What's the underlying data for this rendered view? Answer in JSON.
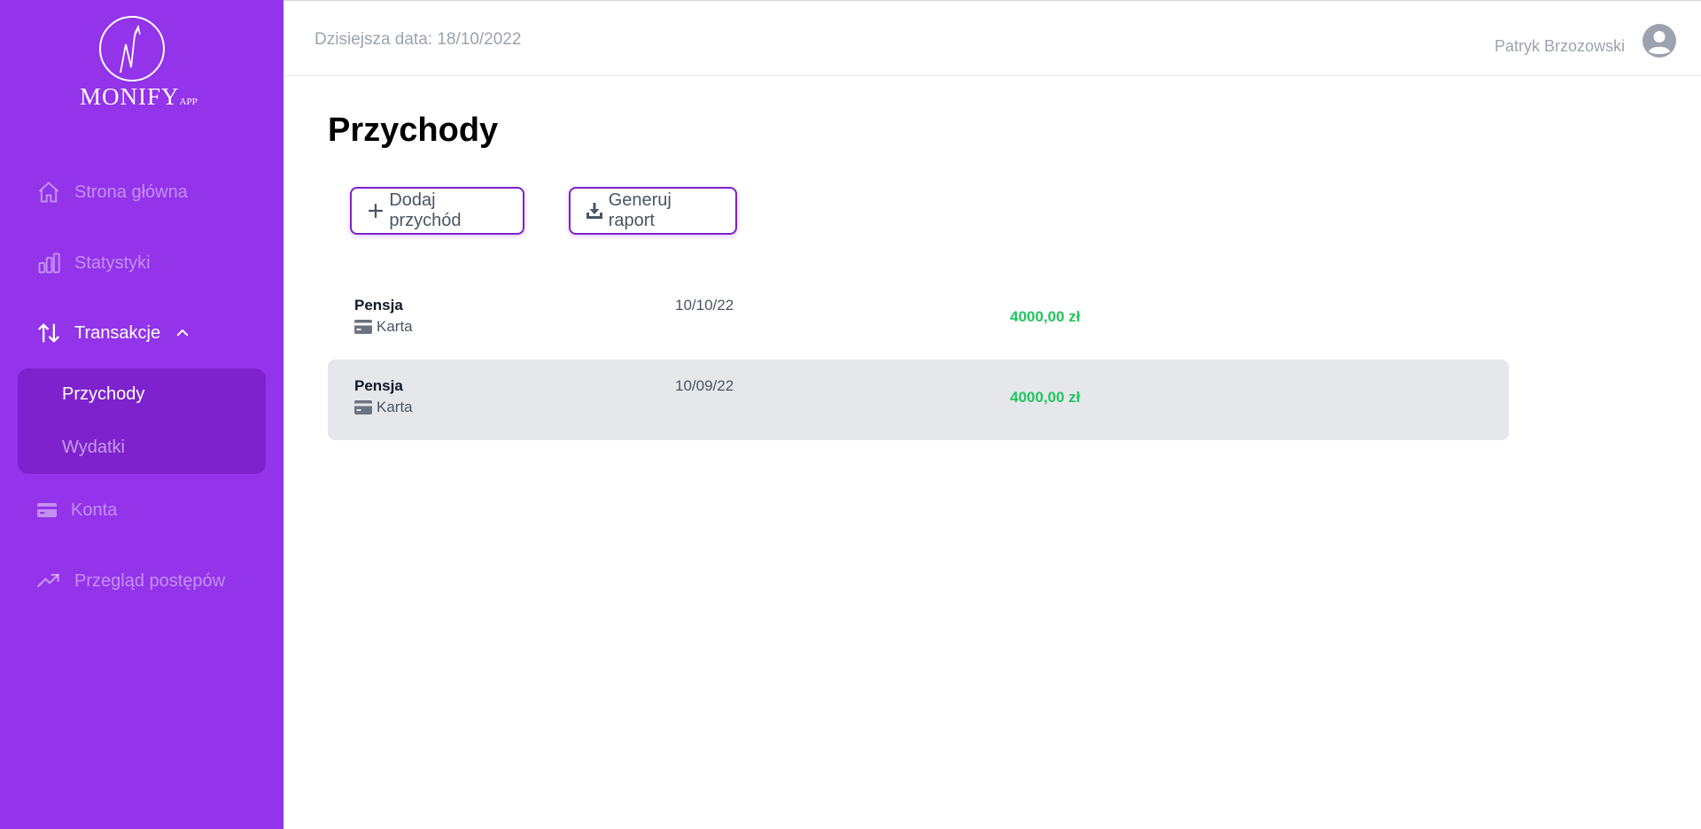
{
  "app": {
    "logo_text": "MONIFY",
    "logo_suffix": "APP"
  },
  "sidebar": {
    "items": [
      {
        "label": "Strona główna",
        "icon": "home-icon"
      },
      {
        "label": "Statystyki",
        "icon": "bar-chart-icon"
      },
      {
        "label": "Transakcje",
        "icon": "arrows-up-down-icon",
        "expanded": true
      },
      {
        "label": "Konta",
        "icon": "credit-card-icon"
      },
      {
        "label": "Przegląd postępów",
        "icon": "trending-up-icon"
      }
    ],
    "submenu": [
      {
        "label": "Przychody",
        "active": true
      },
      {
        "label": "Wydatki",
        "active": false
      }
    ]
  },
  "header": {
    "date_text": "Dzisiejsza data: 18/10/2022",
    "user_name": "Patryk Brzozowski"
  },
  "main": {
    "title": "Przychody",
    "buttons": {
      "add": "Dodaj przychód",
      "report": "Generuj raport"
    },
    "transactions": [
      {
        "title": "Pensja",
        "method": "Karta",
        "date": "10/10/22",
        "amount": "4000,00 zł"
      },
      {
        "title": "Pensja",
        "method": "Karta",
        "date": "10/09/22",
        "amount": "4000,00 zł"
      }
    ]
  },
  "colors": {
    "sidebar_bg": "#9333ea",
    "submenu_bg": "#7e22ce",
    "amount_positive": "#22c55e",
    "row_alt_bg": "#e5e7eb"
  }
}
